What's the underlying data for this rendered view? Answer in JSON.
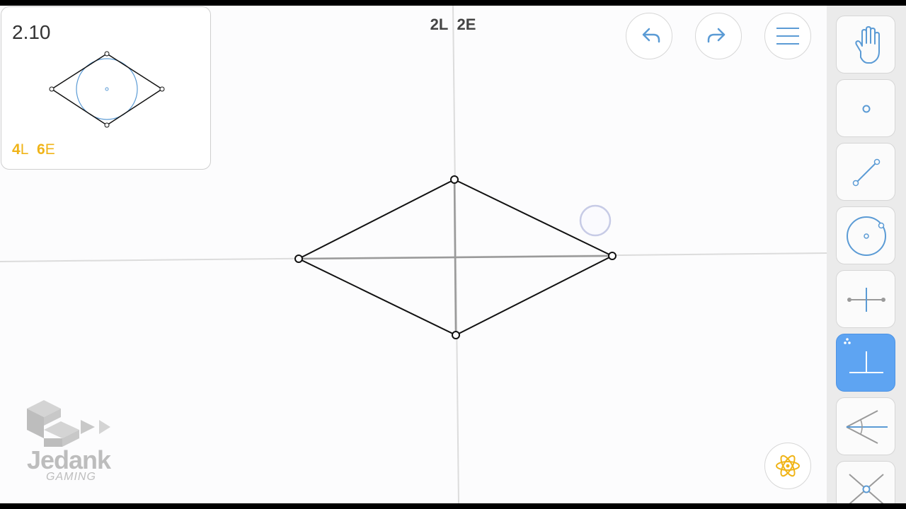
{
  "goal": {
    "level": "2.10",
    "score_lines": "4",
    "score_lines_unit": "L",
    "score_elements": "6",
    "score_elements_unit": "E"
  },
  "current": {
    "lines": "2L",
    "elements": "2E"
  },
  "buttons": {
    "undo": "undo-icon",
    "redo": "redo-icon",
    "menu": "menu-icon",
    "hint": "hint-atom-icon"
  },
  "tools": [
    {
      "name": "move",
      "icon": "hand-icon"
    },
    {
      "name": "point",
      "icon": "point-icon"
    },
    {
      "name": "line",
      "icon": "line-icon"
    },
    {
      "name": "circle",
      "icon": "circle-icon"
    },
    {
      "name": "perpendicular-bisector",
      "icon": "perpendicular-bisector-icon"
    },
    {
      "name": "perpendicular",
      "icon": "perpendicular-icon",
      "active": true
    },
    {
      "name": "angle-bisector",
      "icon": "angle-bisector-icon"
    },
    {
      "name": "intersection",
      "icon": "intersection-icon"
    }
  ],
  "watermark": {
    "brand": "Jedank",
    "sub": "GAMING"
  },
  "colors": {
    "accent": "#5ea4f2",
    "goal_score": "#f0b418",
    "construction": "#5b9bd5"
  }
}
